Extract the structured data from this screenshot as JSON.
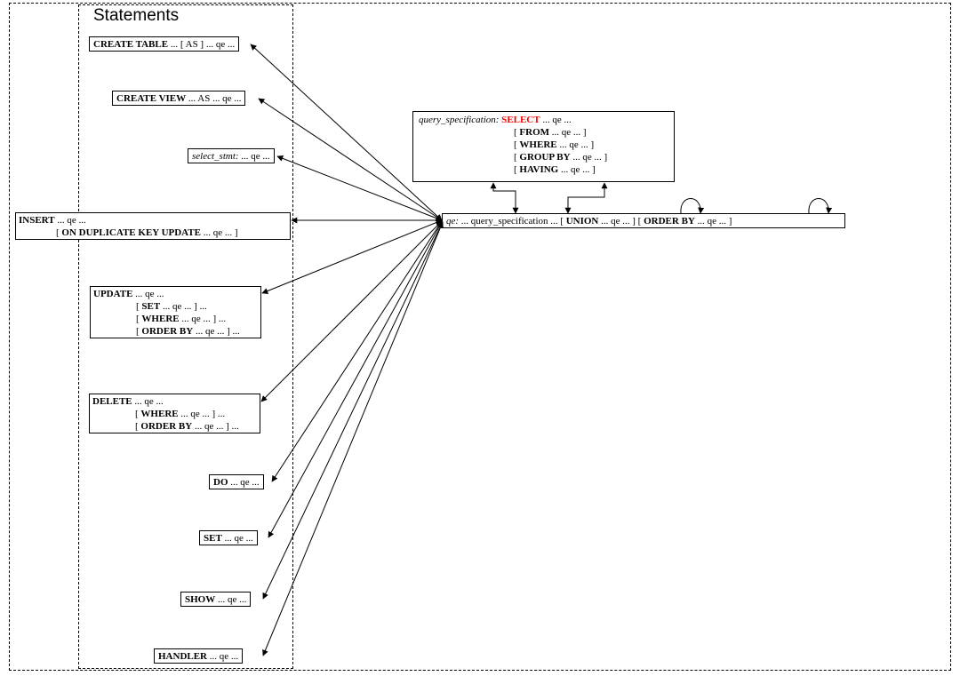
{
  "title": "Statements",
  "nodes": {
    "create_table": {
      "kw": "CREATE TABLE",
      "suffix": " ... [ AS ]   ... qe ..."
    },
    "create_view": {
      "kw": "CREATE VIEW",
      "suffix": " ... AS   ... qe ..."
    },
    "select_stmt": {
      "label_italic": "select_stmt:",
      "suffix": " ... qe ..."
    },
    "insert": {
      "kw": "INSERT",
      "l1_suffix": "  ... qe ...",
      "sub_kw": "ON DUPLICATE KEY UPDATE",
      "sub_suffix": "  ... qe ... ]"
    },
    "update": {
      "kw": "UPDATE",
      "l1_suffix": "   ... qe ...",
      "set_kw": "SET",
      "set_suffix": " ... qe ... ] ...",
      "where_kw": "WHERE",
      "where_suffix": " ... qe ... ] ...",
      "orderby_kw": "ORDER BY",
      "orderby_suffix": " ... qe ... ] ..."
    },
    "delete": {
      "kw": "DELETE",
      "l1_suffix": "    ... qe ...",
      "where_kw": "WHERE",
      "where_suffix": " ... qe ... ] ...",
      "orderby_kw": "ORDER BY",
      "orderby_suffix": " ... qe ... ] ..."
    },
    "do": {
      "kw": "DO",
      "suffix": "  ... qe ..."
    },
    "set": {
      "kw": "SET",
      "suffix": "  ... qe ..."
    },
    "show": {
      "kw": "SHOW",
      "suffix": "  ... qe ..."
    },
    "handler": {
      "kw": "HANDLER",
      "suffix": "  ... qe ..."
    },
    "qe": {
      "label_italic": "qe:",
      "part1": " ... query_specification ... [ ",
      "kw_union": "UNION",
      "part2": "  ... qe ... ] [ ",
      "kw_orderby": "ORDER BY",
      "part3": "  ... qe ... ]"
    },
    "qs": {
      "label_italic": "query_specification:",
      "kw_select": "SELECT",
      "select_suffix": " ... qe ...",
      "kw_from": "FROM",
      "from_suffix": " ... qe ... ]",
      "kw_where": "WHERE",
      "where_suffix": " ... qe ... ]",
      "kw_groupby": "GROUP BY",
      "groupby_suffix": " ... qe ... ]",
      "kw_having": "HAVING",
      "having_suffix": " ... qe ... ]"
    }
  }
}
